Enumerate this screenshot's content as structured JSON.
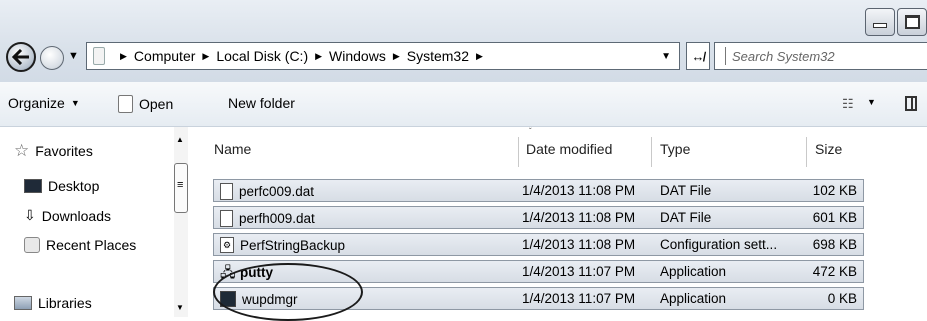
{
  "window": {
    "minimize_icon": "minimize-icon",
    "maximize_icon": "maximize-icon"
  },
  "address": {
    "back_icon": "back-arrow-icon",
    "forward_icon": "forward-arrow-icon",
    "breadcrumbs": [
      {
        "label": "Computer"
      },
      {
        "label": "Local Disk (C:)"
      },
      {
        "label": "Windows"
      },
      {
        "label": "System32"
      }
    ],
    "refresh_icon": "refresh-icon"
  },
  "search": {
    "placeholder": "Search System32"
  },
  "toolbar": {
    "organize_label": "Organize",
    "open_label": "Open",
    "new_folder_label": "New folder",
    "views_icon": "views-icon",
    "preview_pane_icon": "preview-pane-icon"
  },
  "nav": {
    "favorites_label": "Favorites",
    "items": [
      {
        "label": "Desktop",
        "icon": "desktop-icon"
      },
      {
        "label": "Downloads",
        "icon": "downloads-icon"
      },
      {
        "label": "Recent Places",
        "icon": "recent-places-icon"
      }
    ],
    "libraries_label": "Libraries"
  },
  "columns": {
    "name": "Name",
    "date": "Date modified",
    "type": "Type",
    "size": "Size"
  },
  "files": [
    {
      "name": "perfc009.dat",
      "date": "1/4/2013 11:08 PM",
      "type": "DAT File",
      "size": "102 KB",
      "icon": "file-icon"
    },
    {
      "name": "perfh009.dat",
      "date": "1/4/2013 11:08 PM",
      "type": "DAT File",
      "size": "601 KB",
      "icon": "file-icon"
    },
    {
      "name": "PerfStringBackup",
      "date": "1/4/2013 11:08 PM",
      "type": "Configuration sett...",
      "size": "698 KB",
      "icon": "config-file-icon"
    },
    {
      "name": "putty",
      "date": "1/4/2013 11:07 PM",
      "type": "Application",
      "size": "472 KB",
      "icon": "putty-icon"
    },
    {
      "name": "wupdmgr",
      "date": "1/4/2013 11:07 PM",
      "type": "Application",
      "size": "0 KB",
      "icon": "application-icon"
    }
  ]
}
